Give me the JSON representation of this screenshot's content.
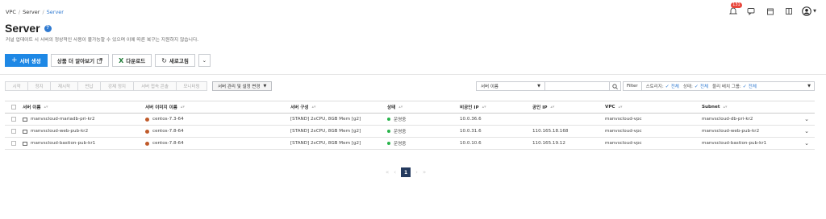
{
  "breadcrumb": [
    "VPC",
    "Server",
    "Server"
  ],
  "header": {
    "title": "Server",
    "help_icon": "?",
    "subtitle": "커널 업데이트 시 서버의 정상적인 사용이 불가능할 수 있으며 이에 따른 복구는 지원하지 않습니다.",
    "notification_count": "131"
  },
  "actions": {
    "create": "서버 생성",
    "learn_more": "상품 더 알아보기",
    "download": "다운로드",
    "refresh": "새로고침"
  },
  "tools": {
    "buttons": [
      "시작",
      "정지",
      "재시작",
      "반납",
      "강제 정지",
      "서버 접속 콘솔",
      "모니터링"
    ],
    "manage": "서버 관리 및 설정 변경"
  },
  "search": {
    "field": "서버 이름",
    "value": ""
  },
  "filters": {
    "label": "Filter",
    "storage_label": "스토리지:",
    "storage_value": "전체",
    "status_label": "상태:",
    "status_value": "전체",
    "placement_label": "물리 배치 그룹:",
    "placement_value": "전체"
  },
  "table": {
    "columns": [
      "서버 이름",
      "서버 이미지 이름",
      "서버 구성",
      "상태",
      "비공인 IP",
      "공인 IP",
      "VPC",
      "Subnet"
    ],
    "rows": [
      {
        "name": "manvscloud-mariadb-pri-kr2",
        "image": "centos-7.3-64",
        "spec": "[STAND] 2xCPU, 8GB Mem [g2]",
        "status": "운영중",
        "private_ip": "10.0.36.6",
        "public_ip": "",
        "vpc": "manvscloud-vpc",
        "subnet": "manvscloud-db-pri-kr2"
      },
      {
        "name": "manvscloud-web-pub-kr2",
        "image": "centos-7.8-64",
        "spec": "[STAND] 2xCPU, 8GB Mem [g2]",
        "status": "운영중",
        "private_ip": "10.0.31.6",
        "public_ip": "110.165.18.168",
        "vpc": "manvscloud-vpc",
        "subnet": "manvscloud-web-pub-kr2"
      },
      {
        "name": "manvscloud-bastion-pub-kr1",
        "image": "centos-7.8-64",
        "spec": "[STAND] 2xCPU, 8GB Mem [g2]",
        "status": "운영중",
        "private_ip": "10.0.10.6",
        "public_ip": "110.165.19.12",
        "vpc": "manvscloud-vpc",
        "subnet": "manvscloud-bastion-pub-kr1"
      }
    ]
  },
  "pagination": {
    "current": "1"
  },
  "colors": {
    "primary": "#1e88e5",
    "link": "#2f7ad1",
    "running": "#28b44b",
    "page_active": "#243a5e",
    "badge": "#e8473c"
  }
}
